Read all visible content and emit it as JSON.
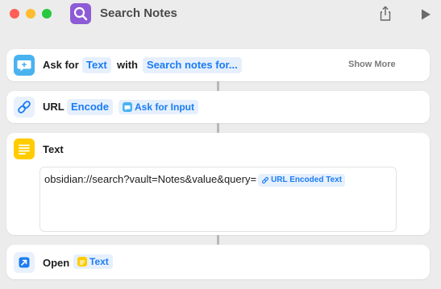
{
  "window": {
    "title": "Search Notes",
    "app_icon": "magnifier-icon",
    "colors": {
      "app_icon": "#8e5bd6",
      "traffic_red": "#ff5f57",
      "traffic_yellow": "#febc2e",
      "traffic_green": "#28c840"
    }
  },
  "toolbar": {
    "share_icon": "share-icon",
    "run_icon": "play-icon"
  },
  "actions": [
    {
      "label": "Ask for",
      "icon": "ask-input-icon",
      "icon_color": "#49b3f0",
      "param1": "Text",
      "keyword": "with",
      "param2": "Search notes for...",
      "show_more": "Show More"
    },
    {
      "label": "URL",
      "icon": "link-icon",
      "icon_color": "#e8f1fc",
      "param1": "Encode",
      "variable": "Ask for Input"
    },
    {
      "label": "Text",
      "icon": "text-lines-icon",
      "icon_color": "#ffcc00",
      "content": "obsidian://search?vault=Notes&value&query=",
      "variable": "URL Encoded Text"
    },
    {
      "label": "Open",
      "icon": "open-url-icon",
      "icon_color": "#e8f1fc",
      "variable": "Text"
    }
  ],
  "colors": {
    "accent": "#1b7cf3",
    "chip_bg": "#e6f0fd",
    "background": "#ececec"
  }
}
